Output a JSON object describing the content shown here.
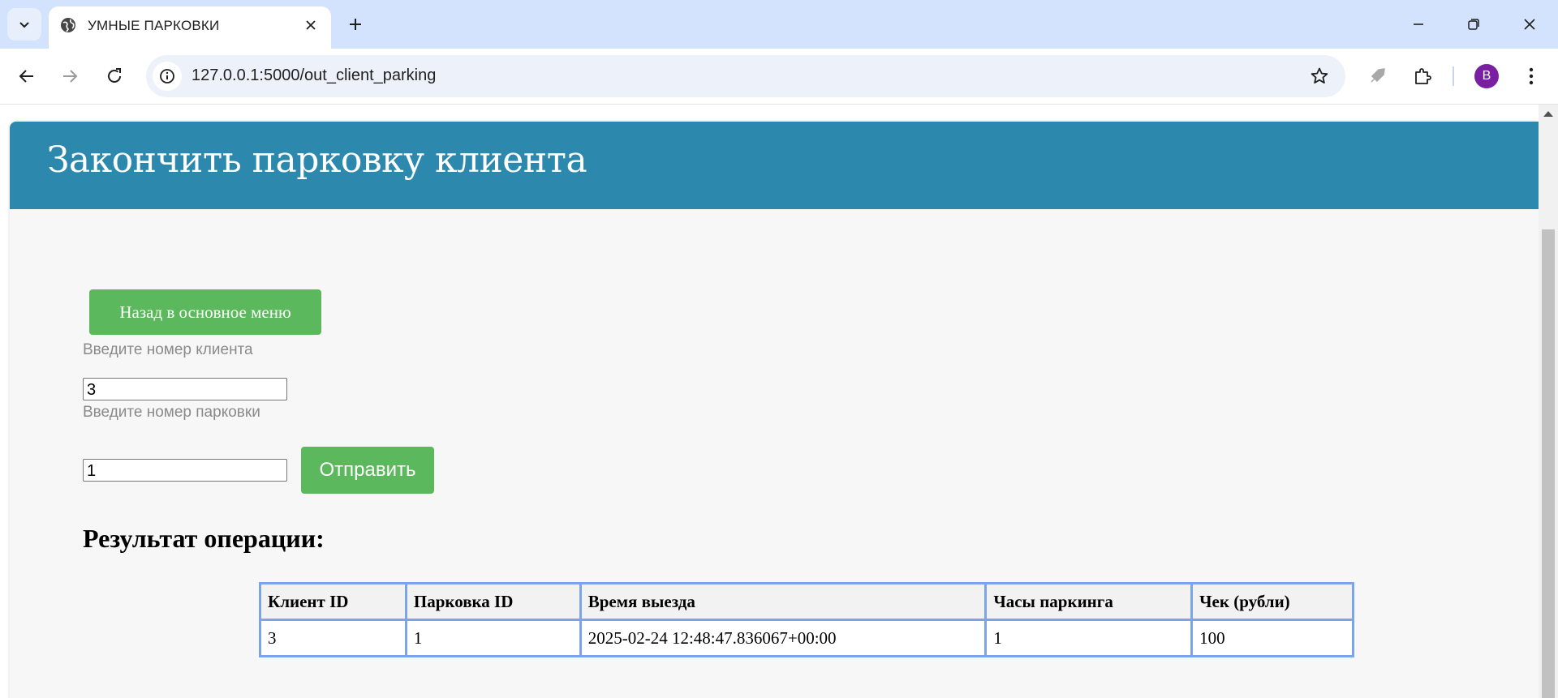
{
  "browser": {
    "tab_title": "УМНЫЕ ПАРКОВКИ",
    "url": "127.0.0.1:5000/out_client_parking",
    "profile_initial": "B",
    "icons": [
      "tab-search-icon",
      "globe-icon",
      "close-icon",
      "plus-icon",
      "minimize-icon",
      "restore-icon",
      "window-close-icon",
      "back-arrow-icon",
      "forward-arrow-icon",
      "reload-icon",
      "info-icon",
      "star-icon",
      "rocket-icon",
      "extensions-icon",
      "more-vert-icon"
    ]
  },
  "page": {
    "header_title": "Закончить парковку клиента",
    "back_button": "Назад в основное меню",
    "client_label": "Введите номер клиента",
    "client_value": "3",
    "parking_label": "Введите номер парковки",
    "parking_value": "1",
    "submit_button": "Отправить",
    "result_heading": "Результат операции:"
  },
  "table": {
    "headers": [
      "Клиент ID",
      "Парковка ID",
      "Время выезда",
      "Часы паркинга",
      "Чек (рубли)"
    ],
    "rows": [
      [
        "3",
        "1",
        "2025-02-24 12:48:47.836067+00:00",
        "1",
        "100"
      ]
    ]
  },
  "colors": {
    "header": "#2c89ad",
    "button": "#5cb85c",
    "table_border": "#7ca4e8",
    "tab_strip": "#d3e3fd",
    "avatar": "#7b1fa2"
  }
}
